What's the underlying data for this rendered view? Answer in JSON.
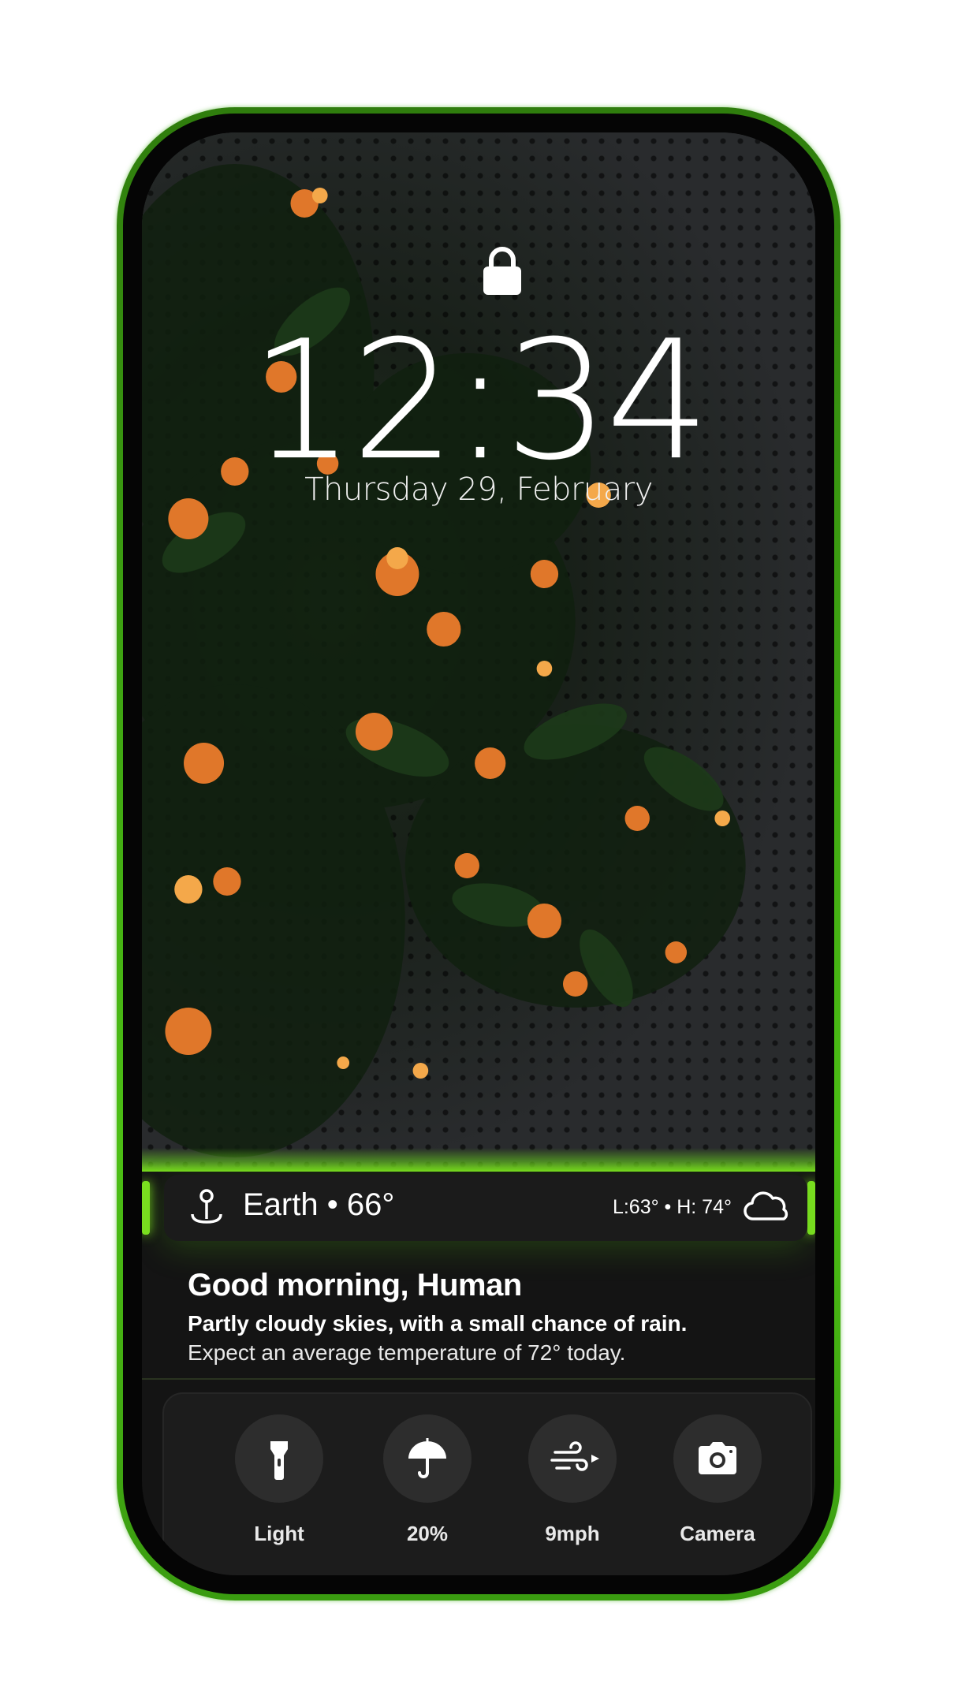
{
  "lockscreen": {
    "time": "12:34",
    "date": "Thursday 29, February"
  },
  "weather_bar": {
    "location_temp": "Earth • 66°",
    "hi_lo": "L:63° • H: 74°",
    "icons": [
      "location-pin-icon",
      "cloud-icon"
    ]
  },
  "greeting": {
    "title": "Good morning, Human",
    "subtitle": "Partly cloudy skies, with a small chance of rain.",
    "detail": "Expect an average temperature of 72° today."
  },
  "dock": {
    "items": [
      {
        "label": "Light",
        "icon": "flashlight-icon"
      },
      {
        "label": "20%",
        "icon": "umbrella-icon"
      },
      {
        "label": "9mph",
        "icon": "wind-icon"
      },
      {
        "label": "Camera",
        "icon": "camera-icon"
      }
    ]
  },
  "colors": {
    "accent": "#7be020",
    "frame": "#3fa612",
    "panel": "#1b1b1b"
  }
}
